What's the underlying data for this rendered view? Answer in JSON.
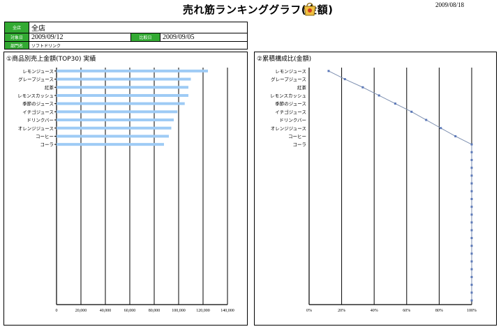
{
  "header": {
    "title": "売れ筋ランキンググラフ(金額)",
    "date": "2009/08/18",
    "logo_icon": "shopping-bag-icon"
  },
  "info": {
    "store_label": "全店",
    "store_value": "全店",
    "target_date_label": "対象日",
    "target_date": "2009/09/12",
    "compare_date_label": "比較日",
    "compare_date": "2009/09/05",
    "department_label": "部門名",
    "department": "ソフトドリンク"
  },
  "chart_data": [
    {
      "type": "bar",
      "orientation": "horizontal",
      "title": "①商品別売上金額(TOP30) 実績",
      "categories": [
        "レモンジュース",
        "グレープジュース",
        "紅茶",
        "レモンスカッシュ",
        "季節のジュース",
        "イチゴジュース",
        "ドリンクバー",
        "オレンジジュース",
        "コーヒー",
        "コーラ"
      ],
      "values": [
        124000,
        110000,
        108000,
        108000,
        105000,
        99000,
        96000,
        94000,
        92000,
        88000
      ],
      "xlim": [
        0,
        140000
      ],
      "xticks": [
        "0",
        "20,000",
        "40,000",
        "60,000",
        "80,000",
        "100,000",
        "120,000",
        "140,000"
      ],
      "grid": true,
      "color": "#9ecbf5"
    },
    {
      "type": "line",
      "orientation": "horizontal",
      "title": "②累積構成比(金額)",
      "categories": [
        "レモンジュース",
        "グレープジュース",
        "紅茶",
        "レモンスカッシュ",
        "季節のジュース",
        "イチゴジュース",
        "ドリンクバー",
        "オレンジジュース",
        "コーヒー",
        "コーラ"
      ],
      "values": [
        12,
        22,
        33,
        43,
        53,
        63,
        72,
        81,
        90,
        100
      ],
      "extra_points_at": 100,
      "extra_points_count": 20,
      "xlim": [
        0,
        100
      ],
      "xticks": [
        "0%",
        "20%",
        "40%",
        "60%",
        "80%",
        "100%"
      ],
      "grid": true,
      "color": "#5b78b8"
    }
  ]
}
